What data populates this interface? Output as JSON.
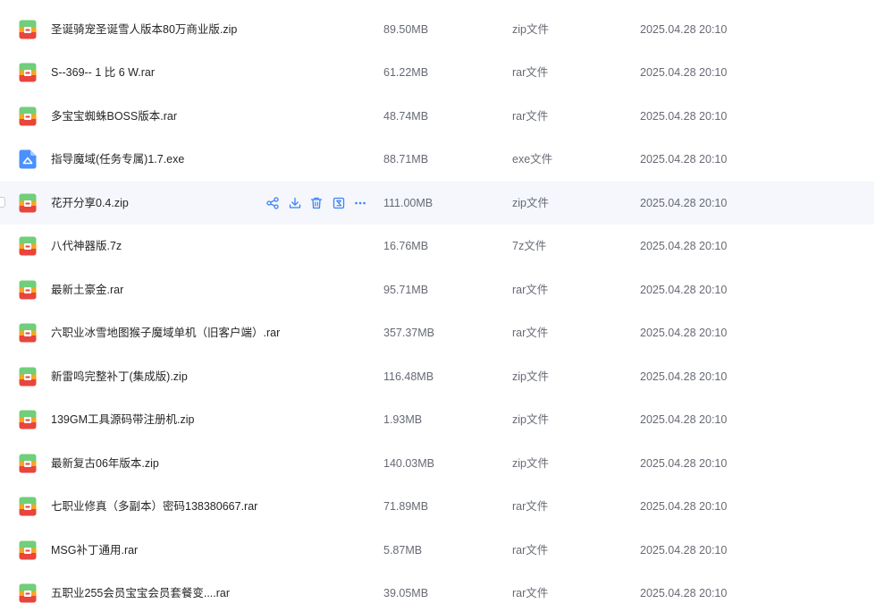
{
  "colors": {
    "accent": "#3b82f6",
    "hover_row": "#f5f7fc",
    "archive_orange": "#f5a623",
    "archive_red": "#e8453c",
    "archive_green": "#56c26b",
    "exe_blue": "#4a90ff"
  },
  "files": [
    {
      "name": "圣诞骑宠圣诞雪人版本80万商业版.zip",
      "size": "89.50MB",
      "type": "zip文件",
      "date": "2025.04.28 20:10",
      "icon": "archive-icon"
    },
    {
      "name": "S--369-- 1 比 6 W.rar",
      "size": "61.22MB",
      "type": "rar文件",
      "date": "2025.04.28 20:10",
      "icon": "archive-icon"
    },
    {
      "name": "多宝宝蜘蛛BOSS版本.rar",
      "size": "48.74MB",
      "type": "rar文件",
      "date": "2025.04.28 20:10",
      "icon": "archive-icon"
    },
    {
      "name": "指导魔域(任务专属)1.7.exe",
      "size": "88.71MB",
      "type": "exe文件",
      "date": "2025.04.28 20:10",
      "icon": "exe-icon"
    },
    {
      "name": "花开分享0.4.zip",
      "size": "111.00MB",
      "type": "zip文件",
      "date": "2025.04.28 20:10",
      "icon": "archive-icon",
      "hover": true
    },
    {
      "name": "八代神器版.7z",
      "size": "16.76MB",
      "type": "7z文件",
      "date": "2025.04.28 20:10",
      "icon": "archive-icon"
    },
    {
      "name": "最新土豪金.rar",
      "size": "95.71MB",
      "type": "rar文件",
      "date": "2025.04.28 20:10",
      "icon": "archive-icon"
    },
    {
      "name": "六职业冰雪地图猴子魔域单机（旧客户端）.rar",
      "size": "357.37MB",
      "type": "rar文件",
      "date": "2025.04.28 20:10",
      "icon": "archive-icon"
    },
    {
      "name": "新雷鸣完整补丁(集成版).zip",
      "size": "116.48MB",
      "type": "zip文件",
      "date": "2025.04.28 20:10",
      "icon": "archive-icon"
    },
    {
      "name": "139GM工具源码带注册机.zip",
      "size": "1.93MB",
      "type": "zip文件",
      "date": "2025.04.28 20:10",
      "icon": "archive-icon"
    },
    {
      "name": "最新复古06年版本.zip",
      "size": "140.03MB",
      "type": "zip文件",
      "date": "2025.04.28 20:10",
      "icon": "archive-icon"
    },
    {
      "name": "七职业修真（多副本）密码138380667.rar",
      "size": "71.89MB",
      "type": "rar文件",
      "date": "2025.04.28 20:10",
      "icon": "archive-icon"
    },
    {
      "name": "MSG补丁通用.rar",
      "size": "5.87MB",
      "type": "rar文件",
      "date": "2025.04.28 20:10",
      "icon": "archive-icon"
    },
    {
      "name": "五职业255会员宝宝会员套餐变....rar",
      "size": "39.05MB",
      "type": "rar文件",
      "date": "2025.04.28 20:10",
      "icon": "archive-icon"
    }
  ],
  "hover_actions": [
    {
      "name": "share-icon"
    },
    {
      "name": "download-icon"
    },
    {
      "name": "delete-icon"
    },
    {
      "name": "extract-icon"
    },
    {
      "name": "more-icon"
    }
  ]
}
